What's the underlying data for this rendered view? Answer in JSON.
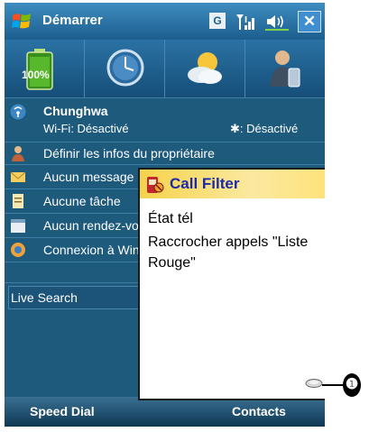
{
  "titlebar": {
    "title": "Démarrer",
    "g_badge": "G",
    "icons": [
      "windows-start-icon",
      "signal-icon",
      "volume-icon",
      "close-icon"
    ]
  },
  "today": {
    "battery_label": "100%",
    "owner_name": "Chunghwa",
    "wifi_status": "Wi-Fi: Désactivé",
    "bluetooth_status": ": Désactivé",
    "rows": [
      {
        "icon": "person-icon",
        "label": "Définir les infos du propriétaire"
      },
      {
        "icon": "mail-icon",
        "label": "Aucun message"
      },
      {
        "icon": "task-icon",
        "label": "Aucune tâche"
      },
      {
        "icon": "calendar-icon",
        "label": "Aucun rendez-vous"
      },
      {
        "icon": "connection-icon",
        "label": "Connexion à Windows Live"
      }
    ],
    "live_search": "Live Search"
  },
  "softkeys": {
    "left": "Speed Dial",
    "right": "Contacts"
  },
  "popup": {
    "title": "Call Filter",
    "line1": "État tél",
    "line2": "Raccrocher appels \"Liste Rouge\""
  },
  "callout": {
    "label": "❶"
  },
  "colors": {
    "screen_bg": "#1e5a7c",
    "title_accent": "#1b2aa8",
    "popup_title_bg": "#f6d24a"
  }
}
